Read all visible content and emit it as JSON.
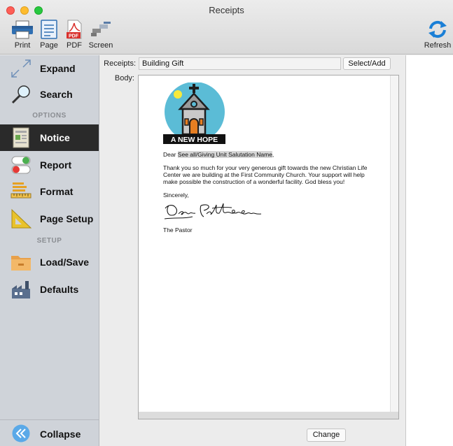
{
  "window": {
    "title": "Receipts"
  },
  "toolbar": {
    "print_label": "Print",
    "page_label": "Page",
    "pdf_label": "PDF",
    "pdf_badge": "PDF",
    "screen_label": "Screen",
    "refresh_label": "Refresh"
  },
  "sidebar": {
    "expand": "Expand",
    "search": "Search",
    "options_heading": "OPTIONS",
    "notice": "Notice",
    "report": "Report",
    "format": "Format",
    "page_setup": "Page Setup",
    "setup_heading": "SETUP",
    "load_save": "Load/Save",
    "defaults": "Defaults",
    "collapse": "Collapse",
    "active_item": "Notice"
  },
  "form": {
    "receipts_label": "Receipts:",
    "receipts_value": "Building Gift",
    "select_add_label": "Select/Add",
    "body_label": "Body:",
    "change_label": "Change"
  },
  "letter": {
    "logo_text": "A NEW HOPE",
    "dear": "Dear ",
    "merge_field": "See all/Giving Unit Salutation Name",
    "salutation_end": ",",
    "body": "Thank you so much for your very generous gift towards the new Christian Life Center we are building at the First Community Church. Your support will help make possible the construction of a wonderful facility. God bless you!",
    "closing": "Sincerely,",
    "signer": "The Pastor"
  },
  "colors": {
    "sidebar_bg": "#cfd3d9",
    "active_bg": "#2a2a2a",
    "accent_blue": "#1a7fd6",
    "logo_circle": "#5bbcd6"
  }
}
